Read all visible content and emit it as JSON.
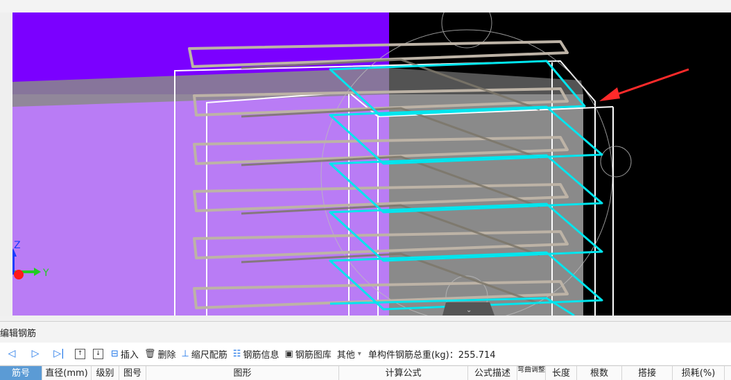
{
  "panel": {
    "title": "编辑钢筋"
  },
  "toolbar": {
    "nav": {
      "first": "◁",
      "prev": "▷",
      "last": "▷|"
    },
    "move_up_icon": "arrow-up-box-icon",
    "move_down_icon": "arrow-down-box-icon",
    "insert": "插入",
    "delete": "删除",
    "scale": "缩尺配筋",
    "info": "钢筋信息",
    "library": "钢筋图库",
    "other": "其他",
    "other_arrow": "▾",
    "weight_label": "单构件钢筋总重(kg)：255.714"
  },
  "grid": {
    "columns": [
      "筋号",
      "直径(mm)",
      "级别",
      "图号",
      "图形",
      "计算公式",
      "公式描述",
      "弯曲调整",
      "长度",
      "根数",
      "搭接",
      "损耗(%)"
    ]
  },
  "viewport": {
    "axis_labels": {
      "z": "Z",
      "y": "Y"
    },
    "colors": {
      "purple_top": "#7b00ff",
      "purple_light": "#b97cf5",
      "gray_band": "#8a8a8a",
      "cyan": "#00e5ee",
      "arrow": "#ff2a2a"
    }
  }
}
